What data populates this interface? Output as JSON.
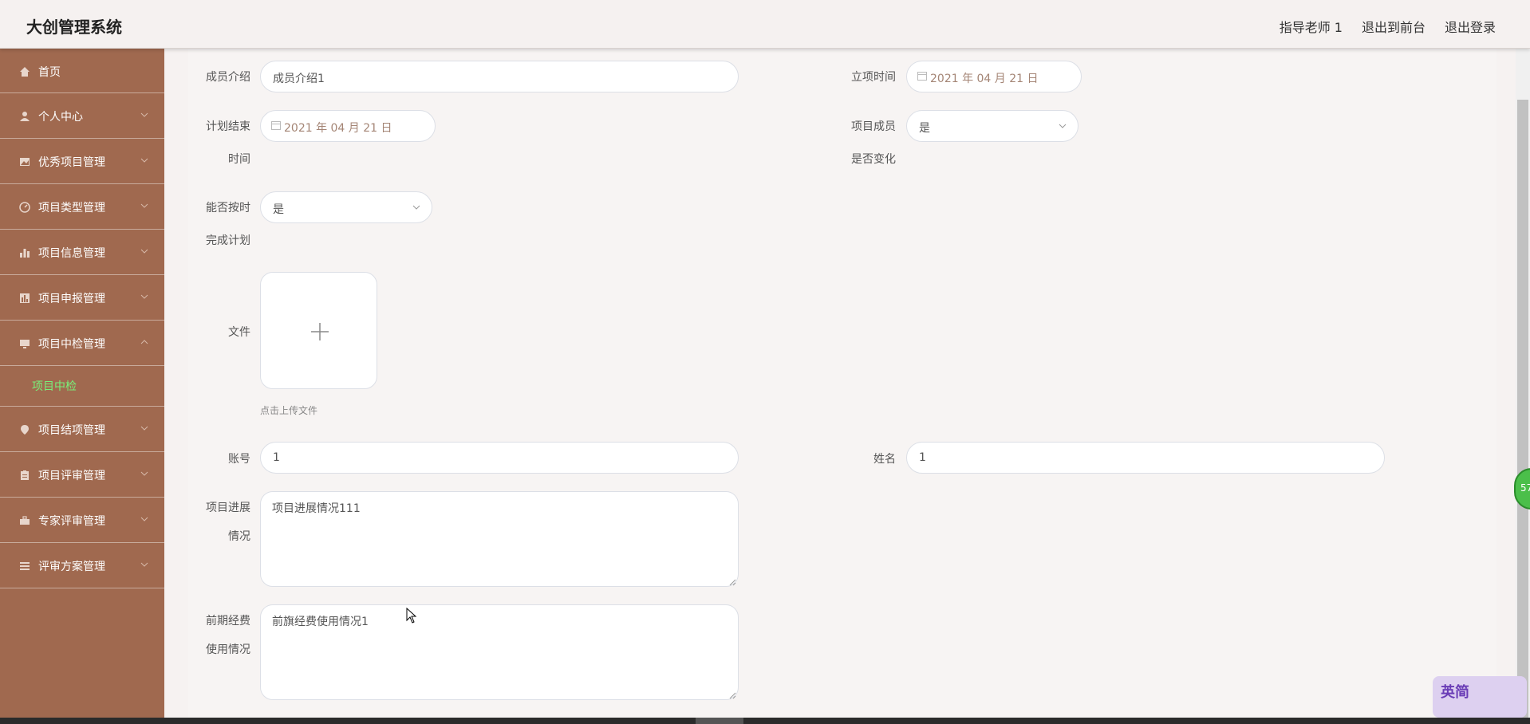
{
  "header": {
    "app_title": "大创管理系统",
    "links": [
      "指导老师 1",
      "退出到前台",
      "退出登录"
    ]
  },
  "sidebar": {
    "items": [
      {
        "label": "首页",
        "icon": "home-icon"
      },
      {
        "label": "个人中心",
        "icon": "user-icon"
      },
      {
        "label": "优秀项目管理",
        "icon": "picture-icon"
      },
      {
        "label": "项目类型管理",
        "icon": "compass-icon"
      },
      {
        "label": "项目信息管理",
        "icon": "bar-chart-icon"
      },
      {
        "label": "项目申报管理",
        "icon": "stats-icon"
      },
      {
        "label": "项目中检管理",
        "icon": "monitor-icon",
        "expanded": true
      },
      {
        "label": "项目结项管理",
        "icon": "location-icon"
      },
      {
        "label": "项目评审管理",
        "icon": "clipboard-icon"
      },
      {
        "label": "专家评审管理",
        "icon": "briefcase-icon"
      },
      {
        "label": "评审方案管理",
        "icon": "menu-icon"
      }
    ],
    "sub_item": "项目中检",
    "sub_item_color": "#78f07a",
    "bg_color": "#a0694f"
  },
  "form": {
    "member_intro": {
      "label": "成员介绍",
      "value": "成员介绍1"
    },
    "project_start": {
      "label": "立项时间",
      "value": "2021 年 04 月 21 日"
    },
    "plan_end": {
      "label_1": "计划结束",
      "label_2": "时间",
      "value": "2021 年 04 月 21 日"
    },
    "member_changed": {
      "label_1": "项目成员",
      "label_2": "是否变化",
      "value": "是"
    },
    "on_schedule": {
      "label_1": "能否按时",
      "label_2": "完成计划",
      "value": "是"
    },
    "file": {
      "label": "文件",
      "hint": "点击上传文件"
    },
    "account": {
      "label": "账号",
      "value": "1"
    },
    "name": {
      "label": "姓名",
      "value": "1"
    },
    "progress": {
      "label_1": "项目进展",
      "label_2": "情况",
      "value": "项目进展情况111"
    },
    "funding": {
      "label_1": "前期经费",
      "label_2": "使用情况",
      "value": "前旗经费使用情况1"
    }
  },
  "overlay": {
    "green_ball_text": "57",
    "ime_text": "英简"
  }
}
